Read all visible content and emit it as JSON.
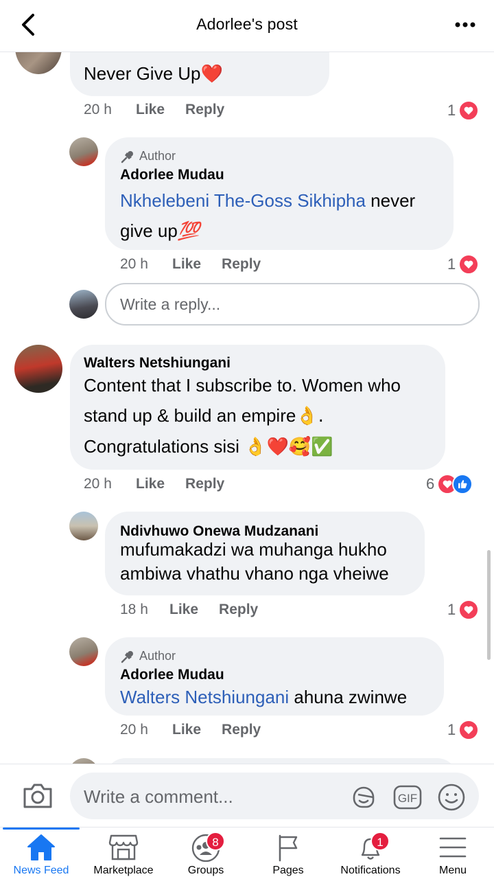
{
  "header": {
    "title": "Adorlee's post"
  },
  "comments": [
    {
      "text": "Never Give Up",
      "emoji": "❤️",
      "time": "20 h",
      "like": "Like",
      "reply": "Reply",
      "reaction_count": "1"
    },
    {
      "author_tag": "Author",
      "name": "Adorlee  Mudau",
      "mention": "Nkhelebeni The-Goss Sikhipha",
      "text_line1": " never",
      "text_line2": "give up",
      "emoji": "💯",
      "time": "20 h",
      "like": "Like",
      "reply": "Reply",
      "reaction_count": "1"
    },
    {
      "name": "Walters Netshiungani",
      "line1": "Content that I subscribe to. Women who",
      "line2": "stand up & build an empire",
      "line2_emoji": "👌.",
      "line3": "Congratulations sisi ",
      "line3_emoji": "👌❤️🥰✅",
      "time": "20 h",
      "like": "Like",
      "reply": "Reply",
      "reaction_count": "6"
    },
    {
      "name": "Ndivhuwo Onewa Mudzanani",
      "line1": "mufumakadzi wa muhanga hukho",
      "line2": "ambiwa vhathu vhano nga vheiwe",
      "time": "18 h",
      "like": "Like",
      "reply": "Reply",
      "reaction_count": "1"
    },
    {
      "author_tag": "Author",
      "name": "Adorlee  Mudau",
      "mention": "Walters Netshiungani",
      "text": " ahuna zwinwe",
      "time": "20 h",
      "like": "Like",
      "reply": "Reply",
      "reaction_count": "1"
    }
  ],
  "reply_box": {
    "placeholder": "Write a reply..."
  },
  "composer": {
    "placeholder": "Write a comment...",
    "gif_label": "GIF"
  },
  "tabs": [
    {
      "label": "News Feed",
      "icon": "home-icon",
      "active": true
    },
    {
      "label": "Marketplace",
      "icon": "marketplace-icon"
    },
    {
      "label": "Groups",
      "icon": "groups-icon",
      "badge": "8"
    },
    {
      "label": "Pages",
      "icon": "pages-flag-icon"
    },
    {
      "label": "Notifications",
      "icon": "bell-icon",
      "badge": "1"
    },
    {
      "label": "Menu",
      "icon": "hamburger-icon"
    }
  ],
  "colors": {
    "accent": "#1877f2",
    "mention": "#2d5fb8",
    "heart": "#f33e58",
    "badge": "#e41e3f",
    "bubble": "#f0f2f5"
  }
}
